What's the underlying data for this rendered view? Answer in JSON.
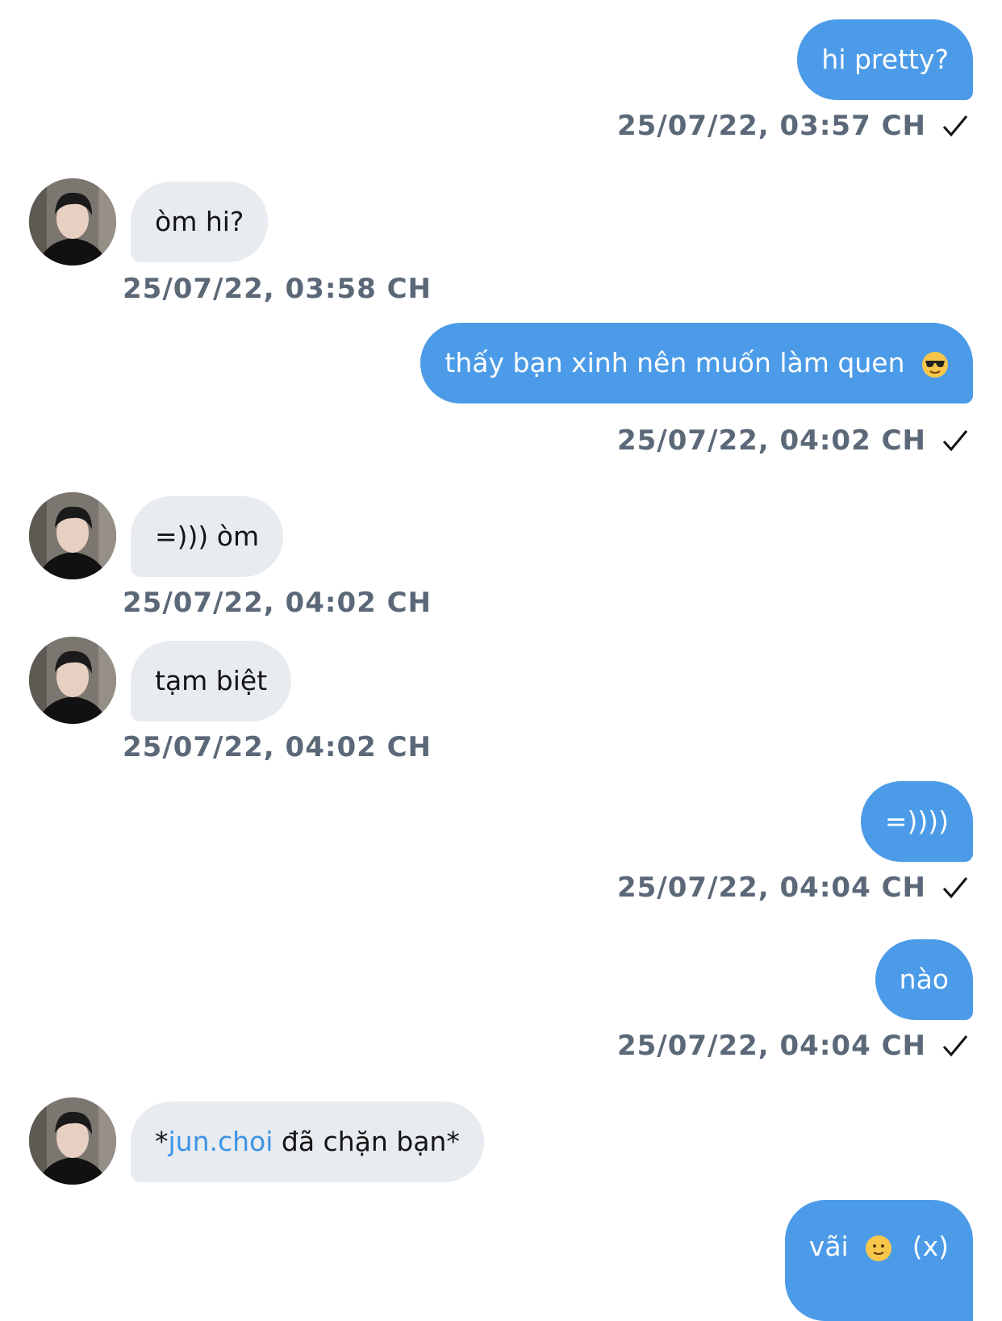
{
  "contact": {
    "username": "jun.choi"
  },
  "messages": [
    {
      "side": "out",
      "text": "hi pretty?",
      "time": "25/07/22, 03:57 CH"
    },
    {
      "side": "in",
      "text": "òm hi?",
      "time": "25/07/22, 03:58 CH"
    },
    {
      "side": "out",
      "text": "thấy bạn xinh nên muốn làm quen",
      "emoji": "sunglasses-emoji",
      "time": "25/07/22, 04:02 CH"
    },
    {
      "side": "in",
      "text": "=))) òm",
      "time": "25/07/22, 04:02 CH"
    },
    {
      "side": "in",
      "text": "tạm biệt",
      "time": "25/07/22, 04:02 CH"
    },
    {
      "side": "out",
      "text": "=))))",
      "time": "25/07/22, 04:04 CH"
    },
    {
      "side": "out",
      "text": "nào",
      "time": "25/07/22, 04:04 CH"
    },
    {
      "side": "in",
      "text_prefix": "*",
      "link": "jun.choi",
      "text_suffix": " đã chặn bạn*"
    },
    {
      "side": "out",
      "text": "vãi",
      "emoji": "slight-smile-emoji",
      "text_suffix": "(x)"
    }
  ],
  "colors": {
    "outgoing_bubble": "#4c9be8",
    "incoming_bubble": "#e8ebef",
    "timestamp": "#5b6878",
    "link": "#3d93e6"
  }
}
